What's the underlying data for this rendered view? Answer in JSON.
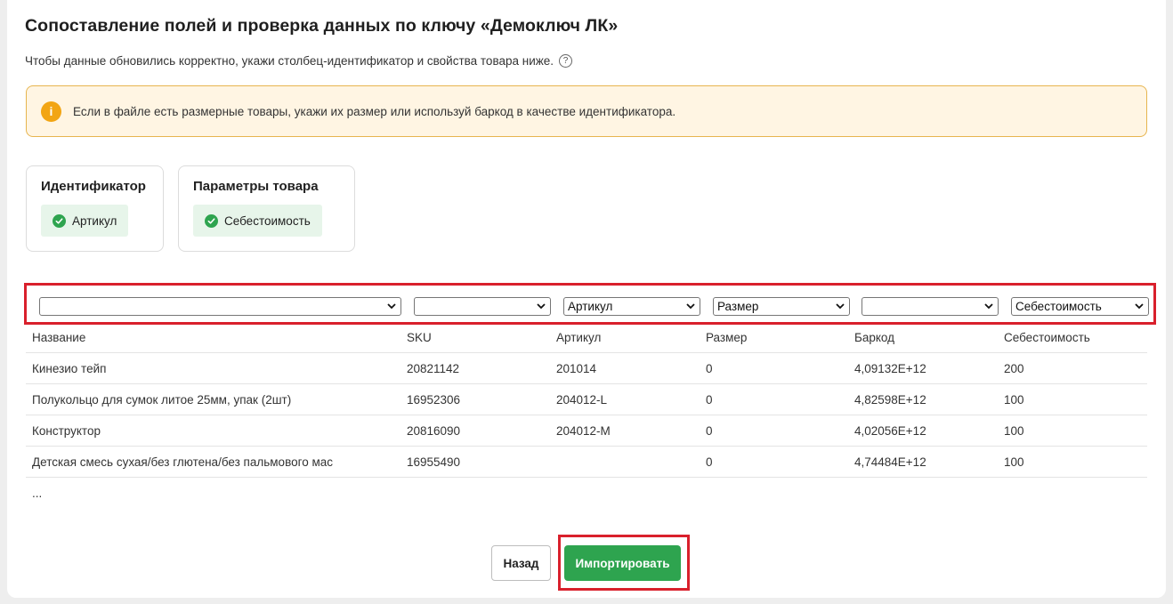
{
  "header": {
    "title": "Сопоставление полей и проверка данных по ключу «Демоключ ЛК»",
    "subtitle": "Чтобы данные обновились корректно, укажи столбец-идентификатор и свойства товара ниже.",
    "help_icon": "?"
  },
  "alert": {
    "icon": "i",
    "text": "Если в файле есть размерные товары, укажи их размер или используй баркод в качестве идентификатора."
  },
  "identifier_box": {
    "title": "Идентификатор",
    "chip": "Артикул"
  },
  "params_box": {
    "title": "Параметры товара",
    "chip": "Себестоимость"
  },
  "column_selects": [
    {
      "value": ""
    },
    {
      "value": ""
    },
    {
      "value": "Артикул"
    },
    {
      "value": "Размер"
    },
    {
      "value": ""
    },
    {
      "value": "Себестоимость"
    }
  ],
  "table": {
    "headers": [
      "Название",
      "SKU",
      "Артикул",
      "Размер",
      "Баркод",
      "Себестоимость"
    ],
    "rows": [
      [
        "Кинезио тейп",
        "20821142",
        "201014",
        "0",
        "4,09132E+12",
        "200"
      ],
      [
        "Полукольцо для сумок литое 25мм, упак (2шт)",
        "16952306",
        "204012-L",
        "0",
        "4,82598E+12",
        "100"
      ],
      [
        "Конструктор",
        "20816090",
        "204012-M",
        "0",
        "4,02056E+12",
        "100"
      ],
      [
        "Детская смесь сухая/без глютена/без пальмового мас",
        "16955490",
        "",
        "0",
        "4,74484E+12",
        "100"
      ]
    ],
    "ellipsis": "..."
  },
  "buttons": {
    "back": "Назад",
    "import": "Импортировать"
  },
  "colors": {
    "accent_green": "#2ea44f",
    "highlight_red": "#d9202c",
    "alert_bg": "#fff5e3",
    "alert_border": "#e7b54f",
    "info_orange": "#f2a514"
  }
}
